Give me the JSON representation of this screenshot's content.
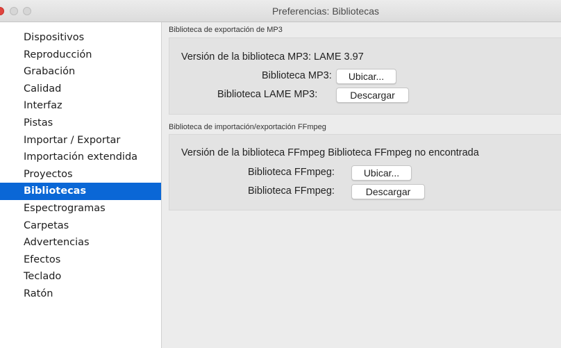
{
  "window": {
    "title": "Preferencias: Bibliotecas"
  },
  "sidebar": {
    "items": [
      {
        "label": "Dispositivos",
        "selected": false
      },
      {
        "label": "Reproducción",
        "selected": false
      },
      {
        "label": "Grabación",
        "selected": false
      },
      {
        "label": "Calidad",
        "selected": false
      },
      {
        "label": "Interfaz",
        "selected": false
      },
      {
        "label": "Pistas",
        "selected": false
      },
      {
        "label": "Importar / Exportar",
        "selected": false
      },
      {
        "label": "Importación extendida",
        "selected": false
      },
      {
        "label": "Proyectos",
        "selected": false
      },
      {
        "label": "Bibliotecas",
        "selected": true
      },
      {
        "label": "Espectrogramas",
        "selected": false
      },
      {
        "label": "Carpetas",
        "selected": false
      },
      {
        "label": "Advertencias",
        "selected": false
      },
      {
        "label": "Efectos",
        "selected": false
      },
      {
        "label": "Teclado",
        "selected": false
      },
      {
        "label": "Ratón",
        "selected": false
      }
    ]
  },
  "mp3_section": {
    "header": "Biblioteca de exportación de MP3",
    "version_label": "Versión de la biblioteca MP3:",
    "version_value": "LAME 3.97",
    "library_label": "Biblioteca MP3:",
    "locate_button": "Ubicar...",
    "lame_label": "Biblioteca LAME MP3:",
    "download_button": "Descargar"
  },
  "ffmpeg_section": {
    "header": "Biblioteca de importación/exportación FFmpeg",
    "version_label": "Versión de la biblioteca FFmpeg",
    "version_value": "Biblioteca FFmpeg no encontrada",
    "library_label": "Biblioteca FFmpeg:",
    "locate_button": "Ubicar...",
    "library_label_2": "Biblioteca FFmpeg:",
    "download_button": "Descargar"
  },
  "colors": {
    "selection": "#0a67d6",
    "close_button": "#e0443e"
  }
}
